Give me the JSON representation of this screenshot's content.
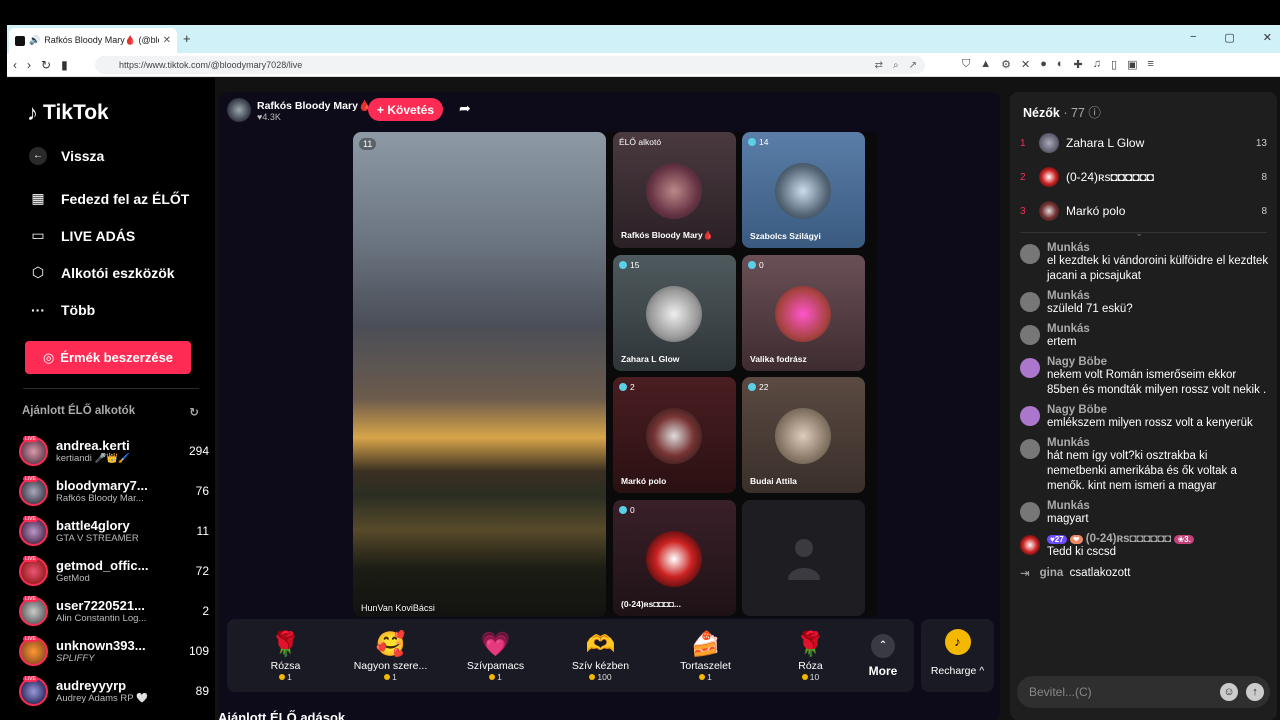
{
  "browser": {
    "tab_title": "Rafkós Bloody Mary🩸 (@blo",
    "url": "https://www.tiktok.com/@bloodymary7028/live"
  },
  "sidebar": {
    "logo": "TikTok",
    "nav": [
      {
        "label": "Vissza",
        "icon": "back-arrow-icon"
      },
      {
        "label": "Fedezd fel az ÉLŐT",
        "icon": "explore-live-icon"
      },
      {
        "label": "LIVE ADÁS",
        "icon": "camera-icon"
      },
      {
        "label": "Alkotói eszközök",
        "icon": "creator-tools-icon"
      },
      {
        "label": "Több",
        "icon": "more-dots-icon"
      }
    ],
    "coin_button": "Érmék beszerzése",
    "recommended_header": "Ajánlott ÉLŐ alkotók",
    "creators": [
      {
        "name": "andrea.kerti",
        "sub": "kertiandi 🎤👑🖌️",
        "count": "294"
      },
      {
        "name": "bloodymary7...",
        "sub": "Rafkós Bloody Mar...",
        "count": "76"
      },
      {
        "name": "battle4glory",
        "sub": "GTA V STREAMER",
        "count": "11"
      },
      {
        "name": "getmod_offic...",
        "sub": "GetMod",
        "count": "72"
      },
      {
        "name": "user7220521...",
        "sub": "Alin Constantin Log...",
        "count": "2"
      },
      {
        "name": "unknown393...",
        "sub": "SPLIFFY",
        "count": "109"
      },
      {
        "name": "audreyyyrp",
        "sub": "Audrey Adams RP 🤍",
        "count": "89"
      }
    ]
  },
  "stream": {
    "host_name": "Rafkós Bloody Mary🩸",
    "host_likes": "♥4.3K",
    "follow_label": "+ Követés",
    "main_tile": {
      "count": "11",
      "name": "HunVan KoviBácsi"
    },
    "tiles": [
      {
        "count": "ÉLŐ alkotó",
        "name": "Rafkós Bloody Mary🩸"
      },
      {
        "count": "14",
        "name": "Szabolcs Szilágyi"
      },
      {
        "count": "15",
        "name": "Zahara L Glow"
      },
      {
        "count": "0",
        "name": "Valika fodrász"
      },
      {
        "count": "2",
        "name": "Markó polo"
      },
      {
        "count": "22",
        "name": "Budai Attila"
      },
      {
        "count": "0",
        "name": "(0-24)ʀs◘◘◘◘..."
      }
    ]
  },
  "gifts": [
    {
      "name": "Rózsa",
      "price": "1",
      "icon": "🌹"
    },
    {
      "name": "Nagyon szere...",
      "price": "1",
      "icon": "🥰"
    },
    {
      "name": "Szívpamacs",
      "price": "1",
      "icon": "💗"
    },
    {
      "name": "Szív kézben",
      "price": "100",
      "icon": "🫶"
    },
    {
      "name": "Tortaszelet",
      "price": "1",
      "icon": "🍰"
    },
    {
      "name": "Róza",
      "price": "10",
      "icon": "🌹"
    }
  ],
  "gift_more": "More",
  "recharge": "Recharge ^",
  "recommended_lives": "Ajánlott ÉLŐ adások",
  "viewers": {
    "title": "Nézők",
    "count": "· 77",
    "list": [
      {
        "rank": "1",
        "name": "Zahara L Glow",
        "count": "13"
      },
      {
        "rank": "2",
        "name": "(0-24)ʀs◘◘◘◘◘◘",
        "count": "8"
      },
      {
        "rank": "3",
        "name": "Markó polo",
        "count": "8"
      }
    ]
  },
  "chat": [
    {
      "user": "Munkás",
      "text": "el kezdtek ki vándoroini külföidre el kezdtek jacani a picsajukat"
    },
    {
      "user": "Munkás",
      "text": "szüleld 71 eskü?"
    },
    {
      "user": "Munkás",
      "text": "ertem"
    },
    {
      "user": "Nagy Böbe",
      "text": "nekem volt Román ismerőseim ekkor 85ben és mondták milyen rossz volt nekik ."
    },
    {
      "user": "Nagy Böbe",
      "text": "emlékszem milyen rossz volt a kenyerük"
    },
    {
      "user": "Munkás",
      "text": "hát nem így volt?ki osztrakba ki nemetbenki amerikába és ők voltak a menők. kint nem ismeri a magyar"
    },
    {
      "user": "Munkás",
      "text": "magyart"
    },
    {
      "user": "(0-24)ʀs◘◘◘◘◘◘",
      "text": "Tedd ki cscsd",
      "badge": "27",
      "badge2": "3."
    }
  ],
  "joined": {
    "user": "gina",
    "text": "csatlakozott"
  },
  "input_placeholder": "Bevitel...(C)"
}
